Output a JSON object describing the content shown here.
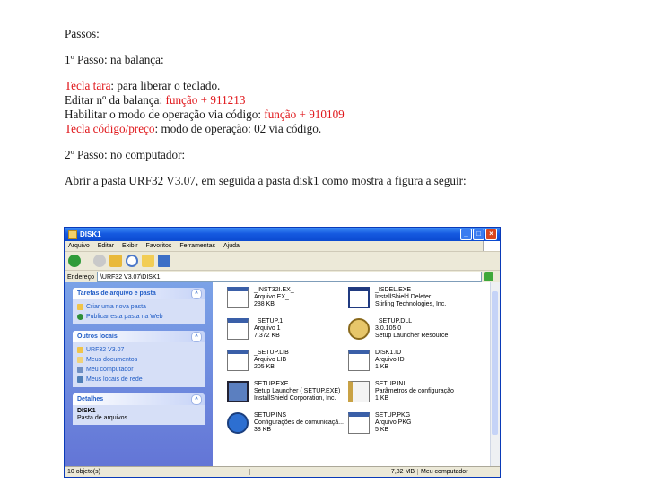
{
  "doc": {
    "heading": "Passos:",
    "step1_title": "1º Passo: na balança:",
    "lines": [
      {
        "red": "Tecla tara",
        "black": ": para liberar o teclado.",
        "tail": ""
      },
      {
        "red": "",
        "black": "Editar nº da balança: ",
        "tail": "função + 911213"
      },
      {
        "red": "",
        "black": "Habilitar o modo de operação via código: ",
        "tail": "função + 910109"
      },
      {
        "red": "Tecla código/preço",
        "black": ": modo de operação: 02 via código.",
        "tail": ""
      }
    ],
    "step2_title": "2º Passo: no computador:",
    "step2_text": "Abrir a pasta URF32 V3.07, em seguida a pasta disk1 como mostra a figura a seguir:"
  },
  "window": {
    "title": "DISK1",
    "menu": [
      "Arquivo",
      "Editar",
      "Exibir",
      "Favoritos",
      "Ferramentas",
      "Ajuda"
    ],
    "address_label": "Endereço",
    "address_value": "\\URF32 V3.07\\DISK1",
    "sidebar": {
      "tasks_title": "Tarefas de arquivo e pasta",
      "tasks": [
        "Criar uma nova pasta",
        "Publicar esta pasta na Web"
      ],
      "places_title": "Outros locais",
      "places": [
        "URF32 V3.07",
        "Meus documentos",
        "Meu computador",
        "Meus locais de rede"
      ],
      "details_title": "Detalhes",
      "details_name": "DISK1",
      "details_type": "Pasta de arquivos"
    },
    "files": [
      {
        "name": "_INST32I.EX_",
        "l2": "Arquivo EX_",
        "l3": "288 KB",
        "icon": "generic",
        "col": 0,
        "row": 0
      },
      {
        "name": "_ISDEL.EXE",
        "l2": "InstallShield Deleter",
        "l3": "Stirling Technologies, Inc.",
        "icon": "window",
        "col": 1,
        "row": 0
      },
      {
        "name": "_SETUP.1",
        "l2": "Arquivo 1",
        "l3": "7.372 KB",
        "icon": "generic",
        "col": 0,
        "row": 1
      },
      {
        "name": "_SETUP.DLL",
        "l2": "3.0.105.0",
        "l3": "Setup Launcher Resource",
        "icon": "gear",
        "col": 1,
        "row": 1
      },
      {
        "name": "_SETUP.LIB",
        "l2": "Arquivo LIB",
        "l3": "205 KB",
        "icon": "generic",
        "col": 0,
        "row": 2
      },
      {
        "name": "DISK1.ID",
        "l2": "Arquivo ID",
        "l3": "1 KB",
        "icon": "generic",
        "col": 1,
        "row": 2
      },
      {
        "name": "SETUP.EXE",
        "l2": "Setup Launcher ( SETUP.EXE)",
        "l3": "InstallShield Corporation, Inc.",
        "icon": "pc",
        "col": 0,
        "row": 3
      },
      {
        "name": "SETUP.INI",
        "l2": "Parâmetros de configuração",
        "l3": "1 KB",
        "icon": "ini",
        "col": 1,
        "row": 3
      },
      {
        "name": "SETUP.INS",
        "l2": "Configurações de comunicaçã...",
        "l3": "38 KB",
        "icon": "globe",
        "col": 0,
        "row": 4
      },
      {
        "name": "SETUP.PKG",
        "l2": "Arquivo PKG",
        "l3": "5 KB",
        "icon": "generic",
        "col": 1,
        "row": 4
      }
    ],
    "status": {
      "objects": "10 objeto(s)",
      "size": "7,82 MB",
      "location": "Meu computador"
    }
  }
}
